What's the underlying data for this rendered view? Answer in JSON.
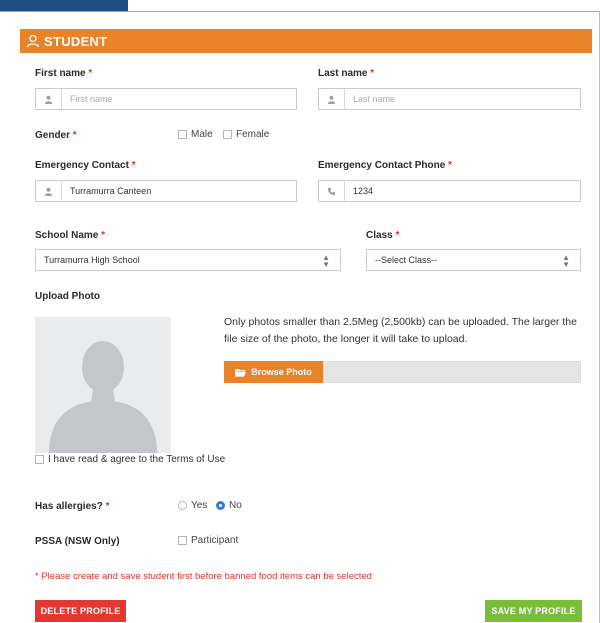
{
  "panel": {
    "title": "STUDENT"
  },
  "form": {
    "first_name": {
      "label": "First name",
      "required": "*",
      "placeholder": "First name",
      "icon": "user-icon"
    },
    "last_name": {
      "label": "Last name",
      "required": "*",
      "placeholder": "Last name",
      "icon": "user-icon"
    },
    "gender": {
      "label": "Gender",
      "required": "*",
      "options": [
        "Male",
        "Female"
      ]
    },
    "emergency_contact": {
      "label": "Emergency Contact",
      "required": "*",
      "value": "Turramurra  Canteen",
      "icon": "user-icon"
    },
    "emergency_phone": {
      "label": "Emergency Contact Phone",
      "required": "*",
      "value": "1234",
      "icon": "phone-icon"
    },
    "school_name": {
      "label": "School Name",
      "required": "*",
      "value": "Turramurra High School"
    },
    "class": {
      "label": "Class",
      "required": "*",
      "value": "--Select Class--"
    },
    "upload_photo": {
      "label": "Upload Photo",
      "note": "Only photos smaller than 2.5Meg (2,500kb) can be uploaded. The larger the file size of the photo, the longer it will take to upload.",
      "browse_label": "Browse Photo"
    },
    "terms": {
      "label": "I have read & agree to the Terms of Use"
    },
    "allergies": {
      "label": "Has allergies?",
      "required": "*",
      "options": [
        "Yes",
        "No"
      ],
      "selected": "No"
    },
    "pssa": {
      "label": "PSSA (NSW Only)",
      "option": "Participant"
    },
    "warning": "* Please create and save student first before banned food items can be selected"
  },
  "actions": {
    "delete_label": "DELETE PROFILE",
    "save_label": "SAVE MY PROFILE"
  },
  "colors": {
    "accent": "#e8832a",
    "danger": "#e03a30",
    "success": "#79be3a",
    "radio_selected": "#2f7be0",
    "corner": "#1d4f82"
  }
}
